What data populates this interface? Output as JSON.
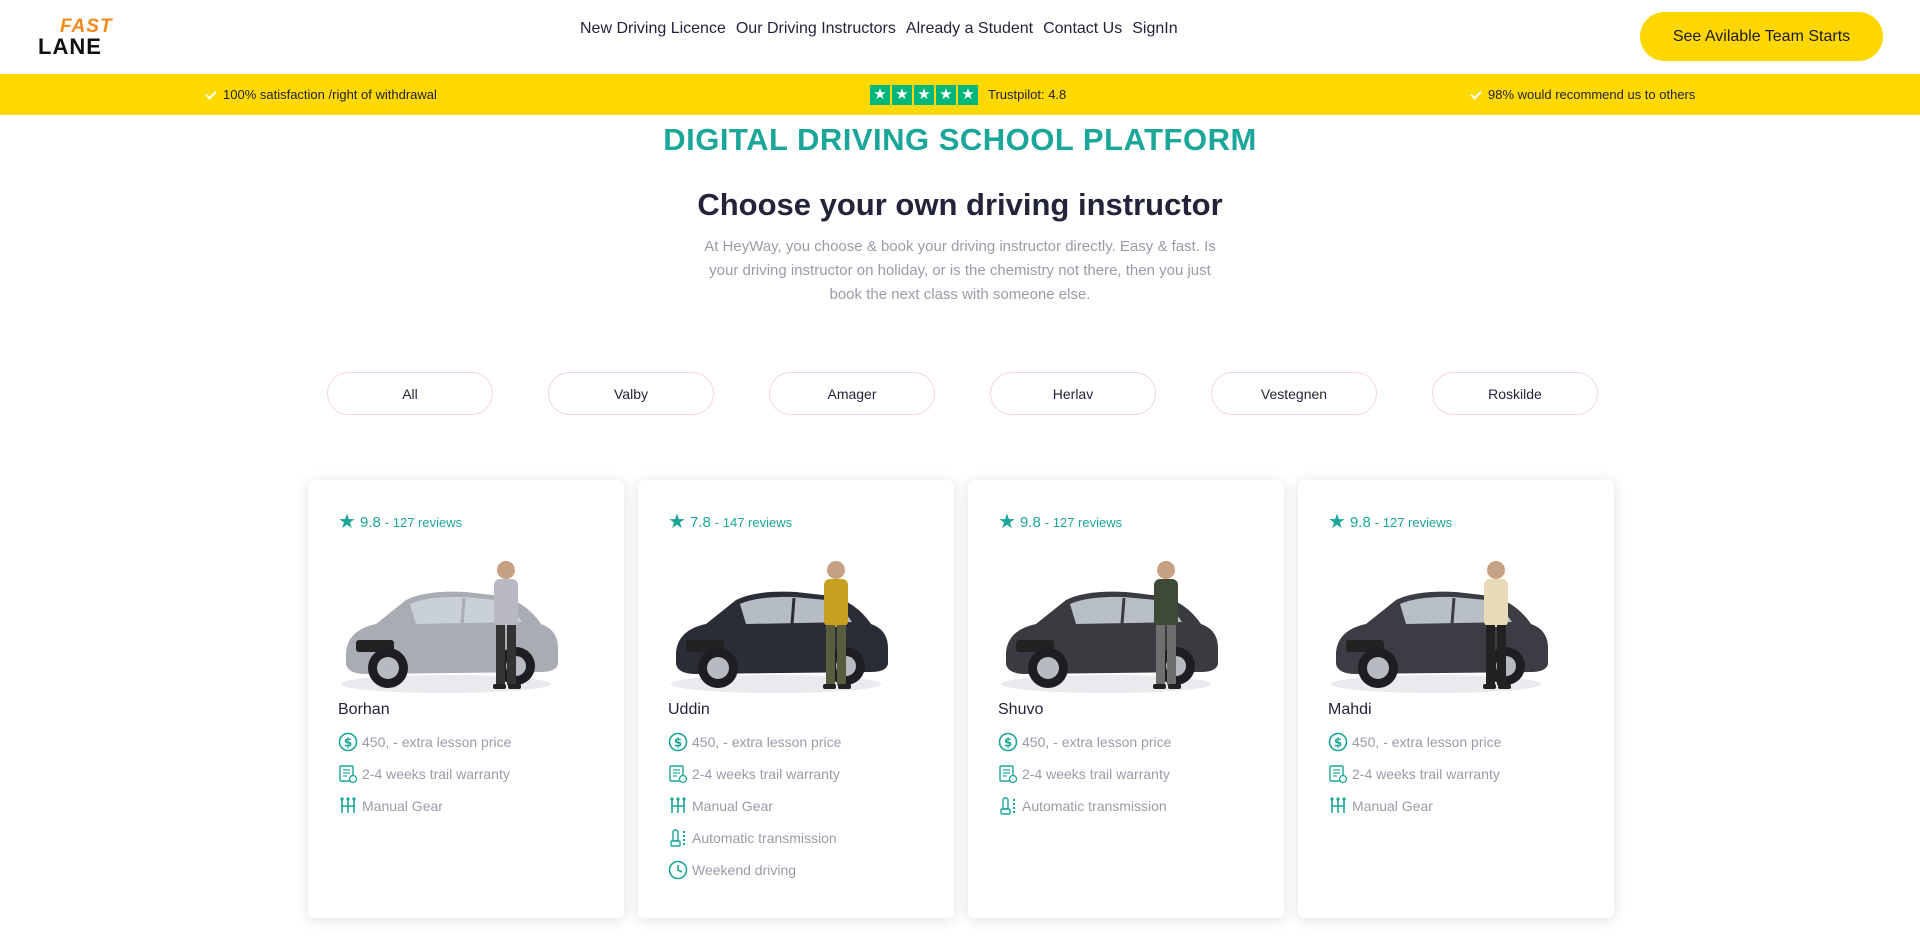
{
  "header": {
    "logo_top": "FAST",
    "logo_bottom": "LANE",
    "nav": [
      "New Driving Licence",
      "Our Driving Instructors",
      "Already a Student",
      "Contact Us",
      "SignIn"
    ],
    "cta_label": "See Avilable Team Starts"
  },
  "trustbar": {
    "left": "100% satisfaction /right of withdrawal",
    "center": "Trustpilot: 4.8",
    "right": "98% would recommend us to others",
    "star_glyph": "★"
  },
  "hero": {
    "kicker": "DIGITAL DRIVING SCHOOL PLATFORM",
    "title": "Choose your own driving instructor",
    "lead": "At HeyWay, you choose & book your driving instructor directly. Easy & fast. Is your driving instructor on holiday, or is the chemistry not there, then you just book the next class with someone else."
  },
  "filters": [
    "All",
    "Valby",
    "Amager",
    "Herlav",
    "Vestegnen",
    "Roskilde"
  ],
  "instructors": [
    {
      "score": "9.8",
      "reviews": "- 127 reviews",
      "name": "Borhan",
      "car_color": "#a9adb3",
      "shirt_color": "#b8b9c4",
      "pants_color": "#333333",
      "features": [
        {
          "icon": "dollar-icon",
          "text": "450, - extra lesson price"
        },
        {
          "icon": "calendar-icon",
          "text": "2-4 weeks trail warranty"
        },
        {
          "icon": "manual-gear-icon",
          "text": "Manual Gear"
        }
      ]
    },
    {
      "score": "7.8",
      "reviews": "- 147 reviews",
      "name": "Uddin",
      "car_color": "#2b2d36",
      "shirt_color": "#c8a020",
      "pants_color": "#5a5c40",
      "features": [
        {
          "icon": "dollar-icon",
          "text": "450, - extra lesson price"
        },
        {
          "icon": "calendar-icon",
          "text": "2-4 weeks trail warranty"
        },
        {
          "icon": "manual-gear-icon",
          "text": "Manual Gear"
        },
        {
          "icon": "automatic-gear-icon",
          "text": "Automatic transmission"
        },
        {
          "icon": "clock-icon",
          "text": "Weekend driving"
        }
      ]
    },
    {
      "score": "9.8",
      "reviews": "- 127 reviews",
      "name": "Shuvo",
      "car_color": "#3a3b40",
      "shirt_color": "#3e4a36",
      "pants_color": "#6e6e6e",
      "features": [
        {
          "icon": "dollar-icon",
          "text": "450, - extra lesson price"
        },
        {
          "icon": "calendar-icon",
          "text": "2-4 weeks trail warranty"
        },
        {
          "icon": "automatic-gear-icon",
          "text": "Automatic transmission"
        }
      ]
    },
    {
      "score": "9.8",
      "reviews": "- 127 reviews",
      "name": "Mahdi",
      "car_color": "#3c3d44",
      "shirt_color": "#e8dcb8",
      "pants_color": "#222222",
      "features": [
        {
          "icon": "dollar-icon",
          "text": "450, - extra lesson price"
        },
        {
          "icon": "calendar-icon",
          "text": "2-4 weeks trail warranty"
        },
        {
          "icon": "manual-gear-icon",
          "text": "Manual Gear"
        }
      ]
    }
  ],
  "colors": {
    "accent": "#1ba69a",
    "yellow": "#ffd900",
    "trustpilot": "#00b67a"
  }
}
